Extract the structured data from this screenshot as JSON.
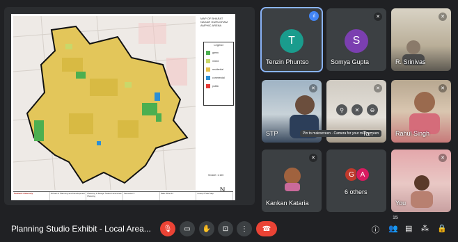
{
  "shared_slide": {
    "map_title": "MAP OF BHARAT NAGAR GURUGRAM AMPHIC ARENA",
    "legend_title": "Legend",
    "legend_items": [
      {
        "label": "green",
        "color": "#4caf50"
      },
      {
        "label": "mixed",
        "color": "#c9d86a"
      },
      {
        "label": "residential",
        "color": "#e6c04a"
      },
      {
        "label": "commercial",
        "color": "#2b8fd6"
      },
      {
        "label": "public",
        "color": "#e53935"
      }
    ],
    "scale": "SCALE: 1:100",
    "north": "N",
    "footer": [
      "Sushant University",
      "School of Planning and Development",
      "Planning & Design Studio Local Area Planning",
      "Semester 4",
      "Date 2022-23",
      "Group 6 Site Map"
    ]
  },
  "participants": [
    {
      "name": "Tenzin Phuntso",
      "initial": "T",
      "avatar_color": "#1a9c8d",
      "speaking": true
    },
    {
      "name": "Somya Gupta",
      "initial": "S",
      "avatar_color": "#7b3fb0",
      "muted": true
    },
    {
      "name": "R. Srinivas",
      "muted": true
    },
    {
      "name": "STP",
      "tooltip": "Pin to mainscreen · Camera for your main screen",
      "muted": true
    },
    {
      "name": "Tan",
      "muted": true
    },
    {
      "name": "Rahul Singh",
      "muted": true
    },
    {
      "name": "Kankan Kataria",
      "muted": true
    },
    {
      "name": "6 others",
      "avatars": [
        "G",
        "A"
      ],
      "avatar_colors": [
        "#c0392b",
        "#d81b60"
      ]
    },
    {
      "name": "You",
      "muted": true
    }
  ],
  "bottom_bar": {
    "meeting_title": "Planning Studio Exhibit - Local Area...",
    "participant_badge": "15",
    "controls": [
      "mic-off",
      "camera-off",
      "raise-hand",
      "present",
      "more",
      "end-call"
    ],
    "right_controls": [
      "info",
      "people",
      "chat",
      "activities",
      "host-controls"
    ]
  }
}
